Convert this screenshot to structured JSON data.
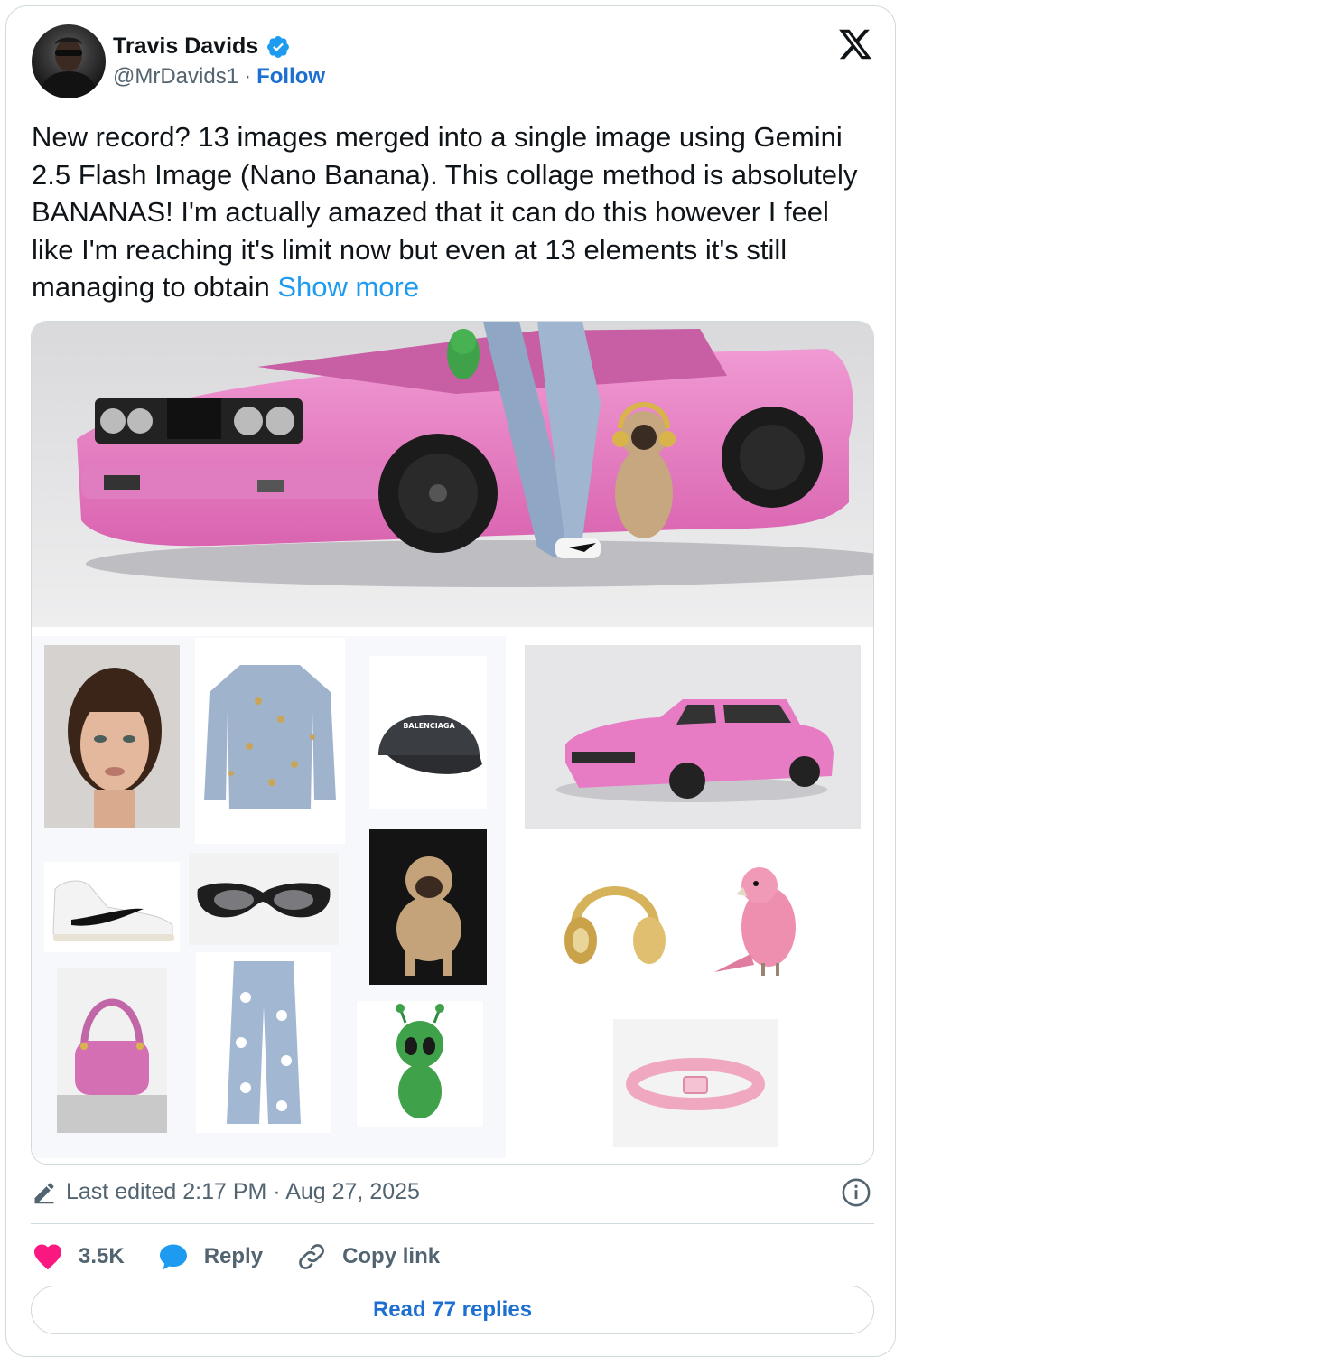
{
  "author": {
    "name": "Travis Davids",
    "handle": "@MrDavids1",
    "separator": "·",
    "follow_label": "Follow",
    "verified": true
  },
  "platform_icon": "x-logo-icon",
  "tweet": {
    "text": "New record? 13 images merged into a single image using Gemini 2.5 Flash Image (Nano Banana). This collage method is absolutely BANANAS! I'm actually amazed that it can do this however I feel like I'm reaching it's limit now but even at 13 elements it's still managing to obtain",
    "show_more_label": "Show more"
  },
  "media": {
    "cap_text": "BALENCIAGA"
  },
  "meta": {
    "edited_text": "Last edited 2:17 PM · Aug 27, 2025"
  },
  "actions": {
    "likes": "3.5K",
    "reply_label": "Reply",
    "copy_link_label": "Copy link"
  },
  "read_replies_label": "Read 77 replies",
  "colors": {
    "accent": "#1d9bf0",
    "follow": "#1d6fd1",
    "like": "#f91880",
    "border": "#cfd9de",
    "car_pink": "#e77cc4"
  }
}
